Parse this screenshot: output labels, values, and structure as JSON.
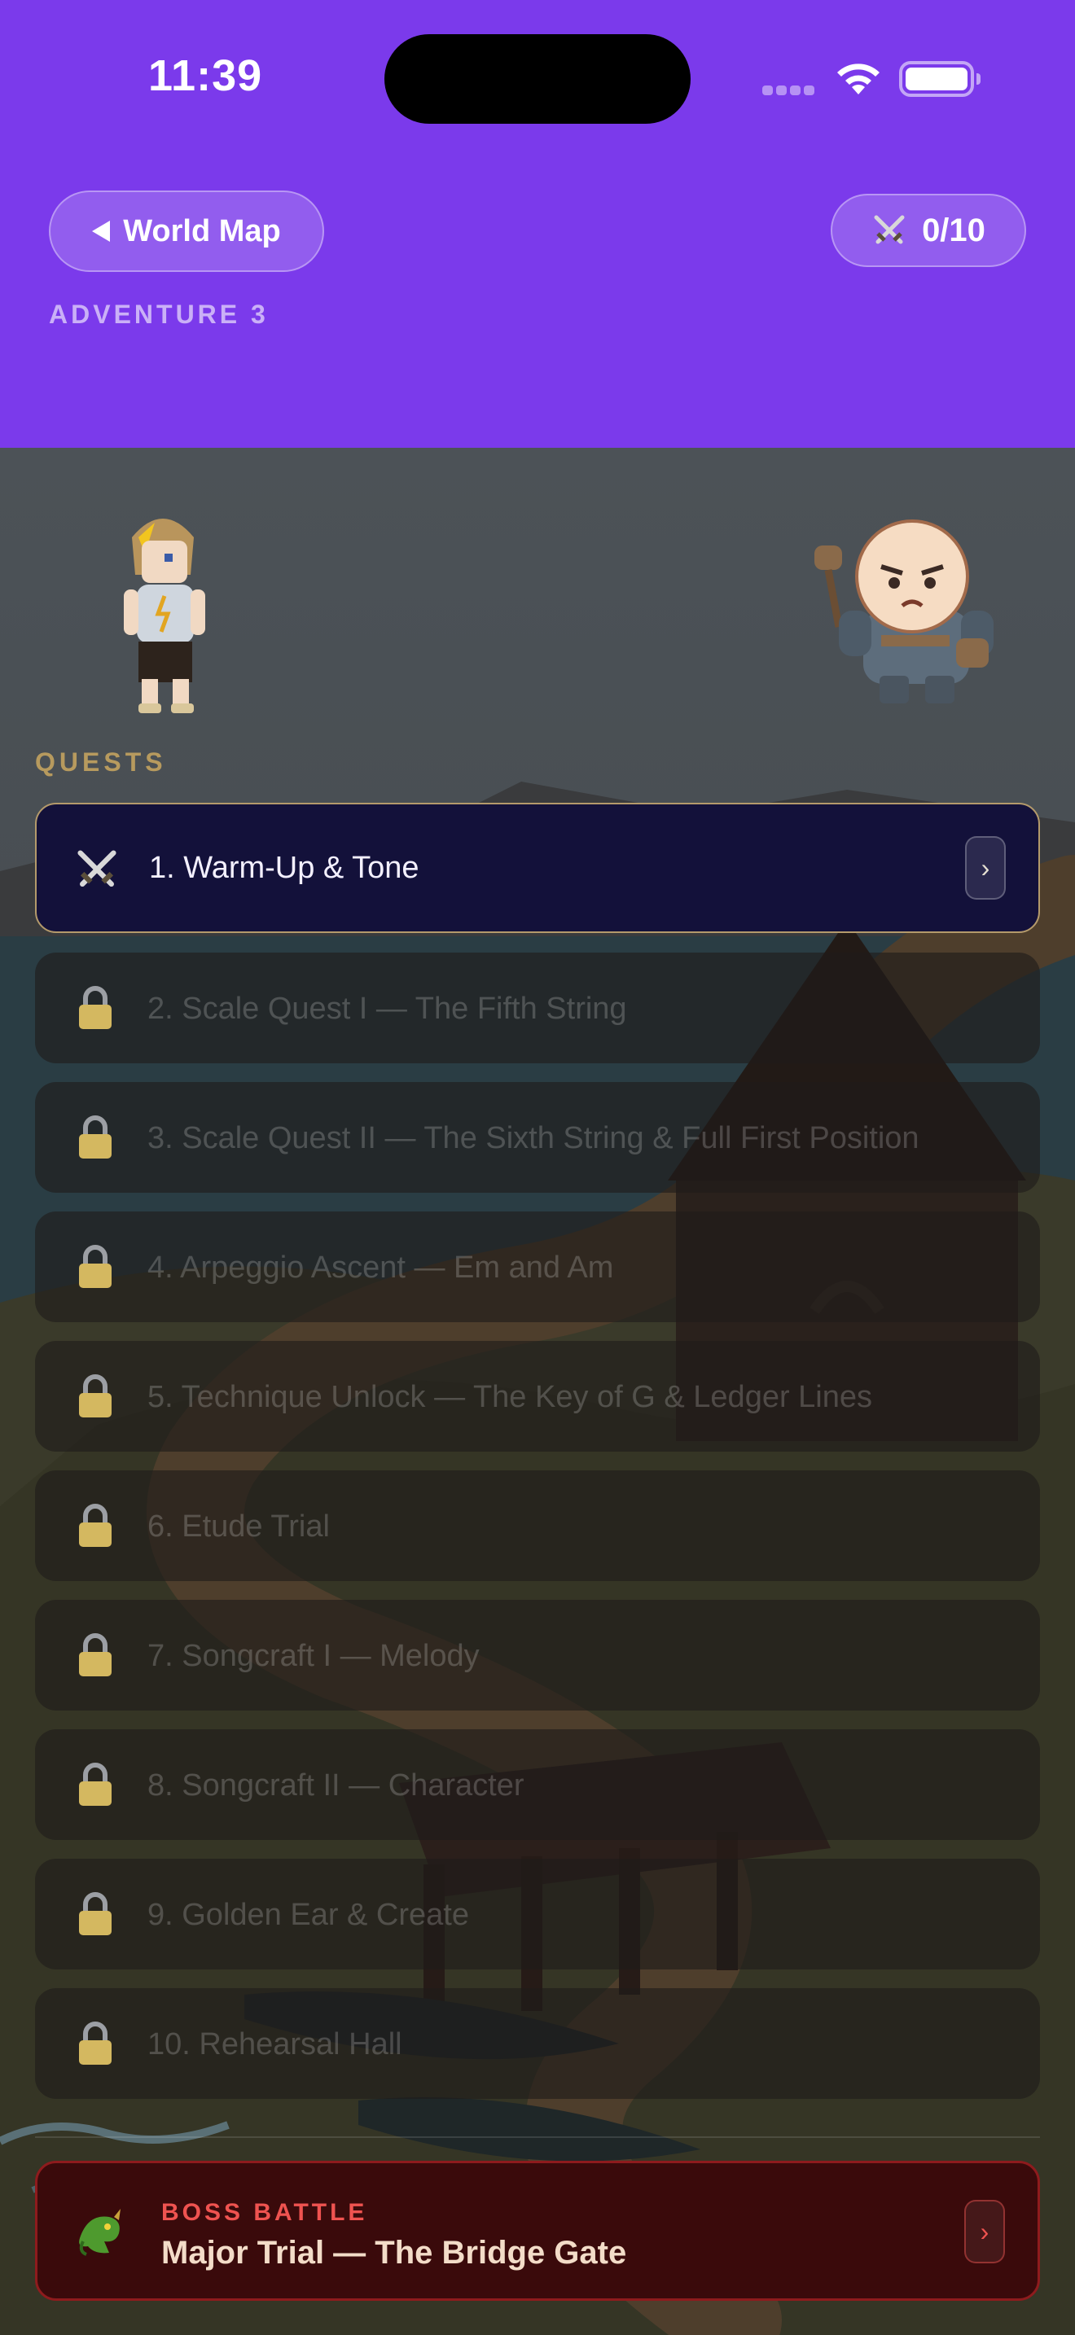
{
  "status_bar": {
    "time": "11:39"
  },
  "header": {
    "back_label": "World Map",
    "score": "0/10",
    "adventure_label": "ADVENTURE 3",
    "accent_color": "#7b3aeb"
  },
  "quests": {
    "section_label": "QUESTS",
    "items": [
      {
        "title": "1. Warm-Up & Tone",
        "state": "active",
        "icon": "swords-icon"
      },
      {
        "title": "2. Scale Quest I — The Fifth String",
        "state": "locked",
        "icon": "lock-icon"
      },
      {
        "title": "3. Scale Quest II — The Sixth String & Full First Position",
        "state": "locked",
        "icon": "lock-icon"
      },
      {
        "title": "4. Arpeggio Ascent — Em and Am",
        "state": "locked",
        "icon": "lock-icon"
      },
      {
        "title": "5. Technique Unlock — The Key of G & Ledger Lines",
        "state": "locked",
        "icon": "lock-icon"
      },
      {
        "title": "6. Etude Trial",
        "state": "locked",
        "icon": "lock-icon"
      },
      {
        "title": "7. Songcraft I — Melody",
        "state": "locked",
        "icon": "lock-icon"
      },
      {
        "title": "8. Songcraft II — Character",
        "state": "locked",
        "icon": "lock-icon"
      },
      {
        "title": "9. Golden Ear & Create",
        "state": "locked",
        "icon": "lock-icon"
      },
      {
        "title": "10. Rehearsal Hall",
        "state": "locked",
        "icon": "lock-icon"
      }
    ]
  },
  "boss": {
    "label": "BOSS BATTLE",
    "title": "Major Trial — The Bridge Gate",
    "icon": "dragon-icon",
    "color": "#ef5350"
  },
  "chevron": "›"
}
